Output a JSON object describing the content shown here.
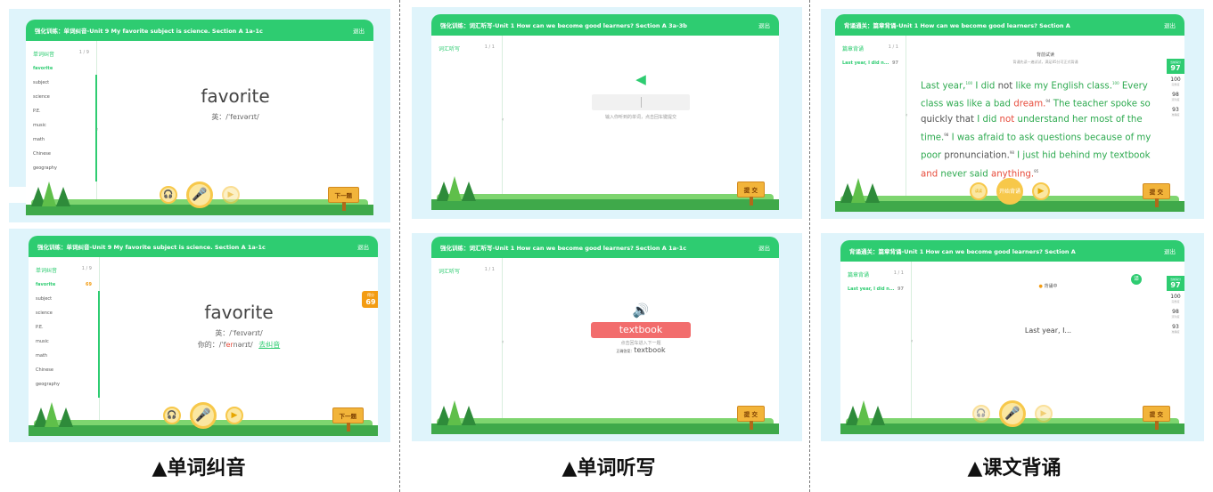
{
  "captions": {
    "left": "▲单词纠音",
    "middle": "▲单词听写",
    "right": "▲课文背诵"
  },
  "common": {
    "exit": "退出",
    "next": "下一题",
    "submit": "提 交"
  },
  "pron": {
    "title": "强化训练：单词纠音-Unit 9 My favorite subject is science. Section A 1a-1c",
    "list_title": "单词纠音",
    "count": "1 / 9",
    "items": [
      "favorite",
      "subject",
      "science",
      "P.E.",
      "music",
      "math",
      "Chinese",
      "geography"
    ],
    "word": "favorite",
    "phonetic": "英：/ˈfeɪvərɪt/",
    "score_label": "得分",
    "score": "69",
    "item_score": "69",
    "your_label": "你的：",
    "your_phon_a": "/ˈf",
    "your_phon_b": "er",
    "your_phon_c": "nərɪt/",
    "correct_link": "去纠音"
  },
  "dict": {
    "title1": "强化训练：词汇听写-Unit 1 How can we become good learners? Section A 3a-3b",
    "title2": "强化训练：词汇听写-Unit 1 How can we become good learners? Section A 1a-1c",
    "list_title": "词汇听写",
    "count": "1 / 1",
    "hint": "输入你听到的单词，点击回车键提交",
    "answer": "textbook",
    "next_hint": "点击回车进入下一题",
    "correct_label": "正确答案：",
    "correct": "textbook"
  },
  "recite": {
    "title1": "背诵通关：篇章背诵-Unit 1 How can we become good learners? Section A",
    "title2": "背诵通关：篇章背诵-Unit 1 How can we become good learners? Section A",
    "list_title": "篇章背诵",
    "count": "1 / 1",
    "item": "Last year, I did n...",
    "item_score": "97",
    "heading": "背前试读",
    "subheading": "背诵先读一遍试试，满足85分可正式背诵",
    "status": "背诵中",
    "preview": "Last year, I...",
    "scores": [
      {
        "v": "97",
        "l": "当前得分"
      },
      {
        "v": "100",
        "l": "完整度"
      },
      {
        "v": "98",
        "l": "流利度"
      },
      {
        "v": "93",
        "l": "准确度"
      }
    ],
    "small_left": "读读",
    "center": "开始背诵",
    "tag": "译"
  }
}
